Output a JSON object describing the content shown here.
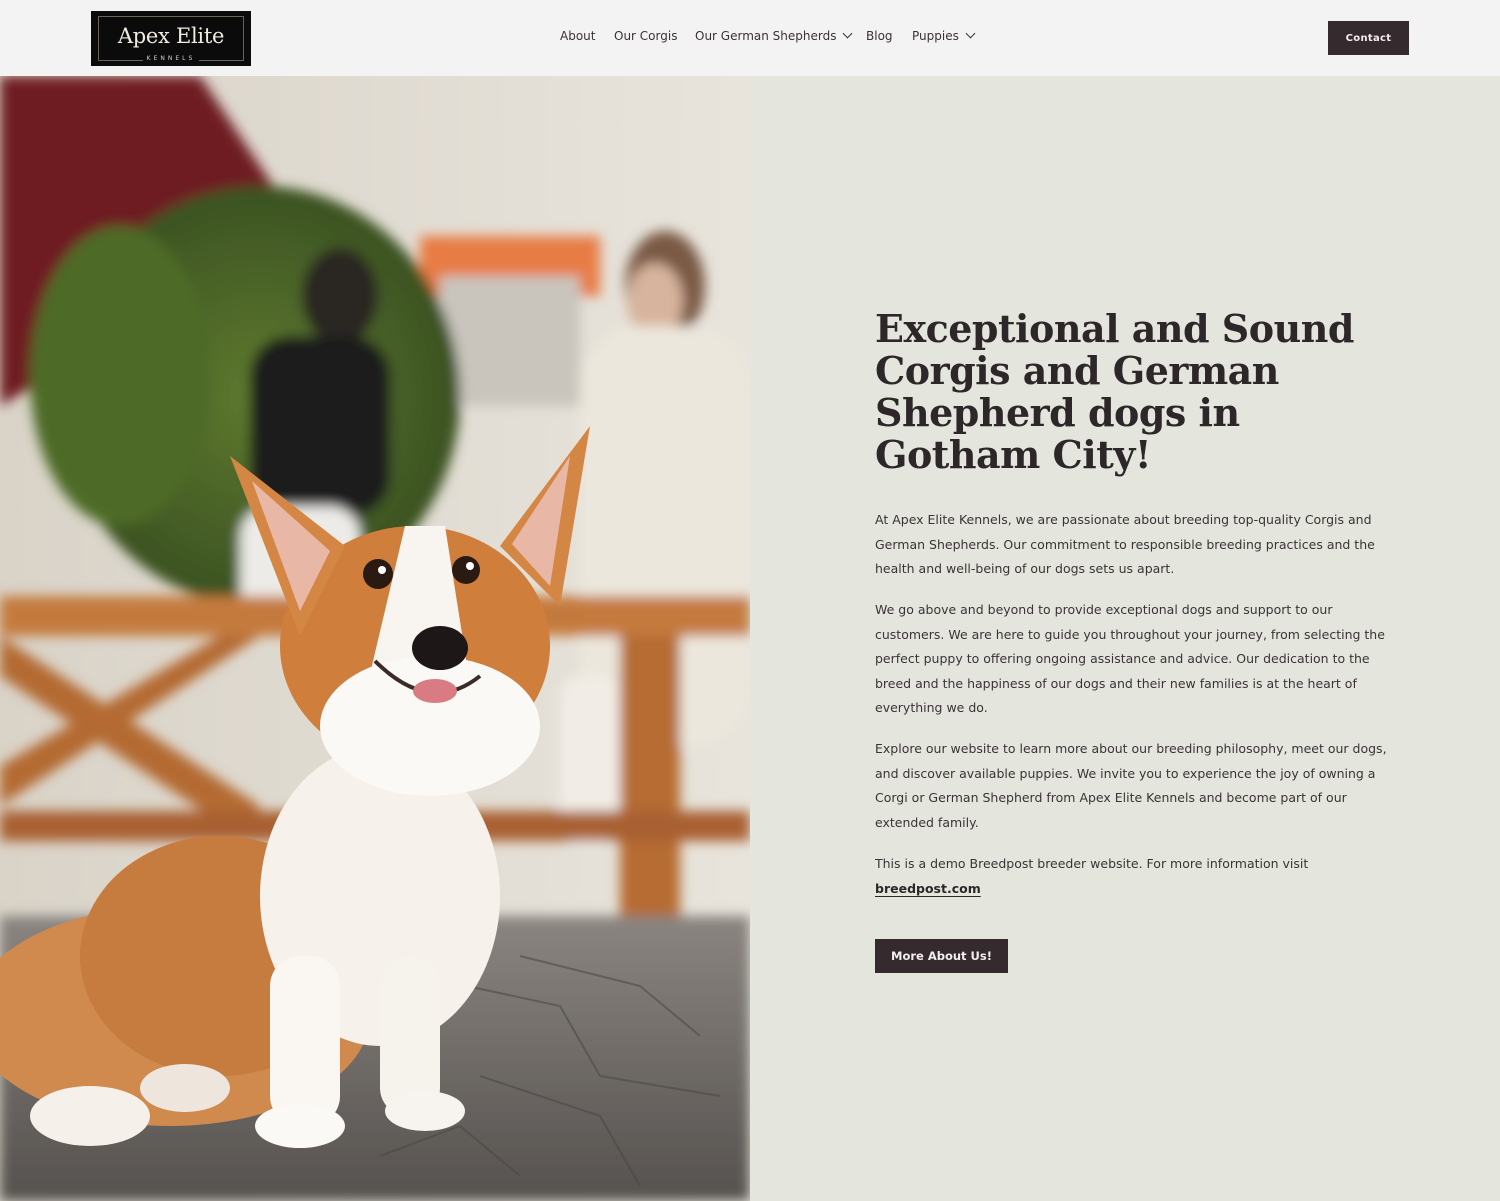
{
  "header": {
    "logo": {
      "title": "Apex Elite",
      "subtitle": "KENNELS"
    },
    "nav": [
      {
        "label": "About",
        "has_dropdown": false
      },
      {
        "label": "Our Corgis",
        "has_dropdown": false
      },
      {
        "label": "Our German Shepherds",
        "has_dropdown": true
      },
      {
        "label": "Blog",
        "has_dropdown": false
      },
      {
        "label": "Puppies",
        "has_dropdown": true
      }
    ],
    "contact_label": "Contact"
  },
  "hero": {
    "image_icon": "corgi-photo"
  },
  "content": {
    "headline": "Exceptional and Sound Corgis and German Shepherd dogs in Gotham City!",
    "paragraphs": [
      "At Apex Elite Kennels, we are passionate about breeding top-quality Corgis and German Shepherds. Our commitment to responsible breeding practices and the health and well-being of our dogs sets us apart.",
      "We go above and beyond to provide exceptional dogs and support to our customers. We are here to guide you throughout your journey, from selecting the perfect puppy to offering ongoing assistance and advice. Our dedication to the breed and the happiness of our dogs and their new families is at the heart of everything we do.",
      "Explore our website to learn more about our breeding philosophy, meet our dogs, and discover available puppies. We invite you to experience the joy of owning a Corgi or German Shepherd from Apex Elite Kennels and become part of our extended family."
    ],
    "demo_text": "This is a demo Breedpost breeder website. For more information visit",
    "demo_link": "breedpost.com",
    "cta_label": "More About Us!"
  },
  "colors": {
    "header_bg": "#f4f3f3",
    "panel_bg": "#e4e6de",
    "button_bg": "#352b2e",
    "text": "#2e2729"
  }
}
